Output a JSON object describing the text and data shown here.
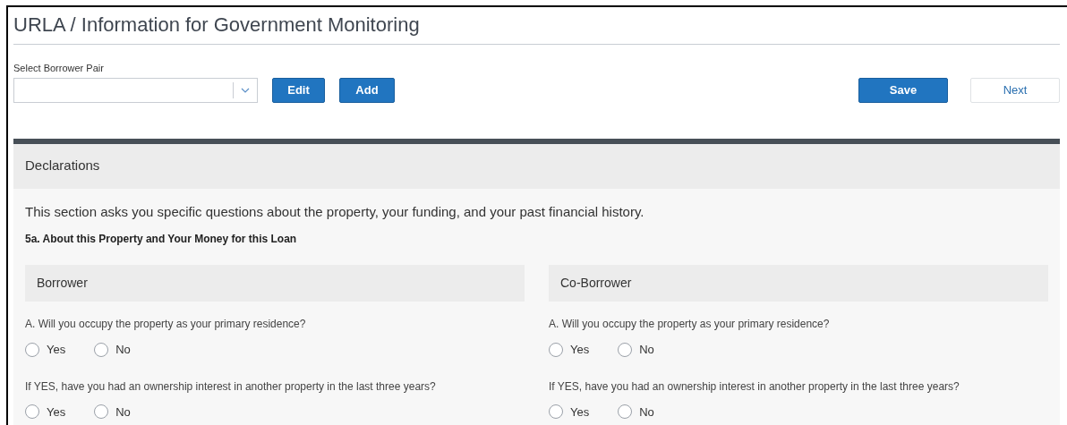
{
  "title": "URLA / Information for Government Monitoring",
  "borrower_pair": {
    "label": "Select Borrower Pair"
  },
  "actions": [
    {
      "label": "Edit",
      "kind": "primary"
    },
    {
      "label": "Add",
      "kind": "primary"
    }
  ],
  "nav": [
    {
      "label": "Save",
      "kind": "primary"
    },
    {
      "label": "Next",
      "kind": "secondary"
    }
  ],
  "section": {
    "title": "Declarations",
    "intro": "This section asks you specific questions about the property, your funding, and your past financial history.",
    "subsection": "5a. About this Property and Your Money for this Loan",
    "columns": [
      {
        "heading": "Borrower",
        "questions": [
          {
            "text": "A. Will you occupy the property as your primary residence?",
            "options": [
              {
                "label": "Yes",
                "selected": false
              },
              {
                "label": "No",
                "selected": false
              }
            ]
          },
          {
            "text": "If YES, have you had an ownership interest in another property in the last three years?",
            "options": [
              {
                "label": "Yes",
                "selected": false
              },
              {
                "label": "No",
                "selected": false
              }
            ]
          }
        ]
      },
      {
        "heading": "Co-Borrower",
        "questions": [
          {
            "text": "A. Will you occupy the property as your primary residence?",
            "options": [
              {
                "label": "Yes",
                "selected": false
              },
              {
                "label": "No",
                "selected": false
              }
            ]
          },
          {
            "text": "If YES, have you had an ownership interest in another property in the last three years?",
            "options": [
              {
                "label": "Yes",
                "selected": false
              },
              {
                "label": "No",
                "selected": false
              }
            ]
          }
        ]
      }
    ]
  }
}
